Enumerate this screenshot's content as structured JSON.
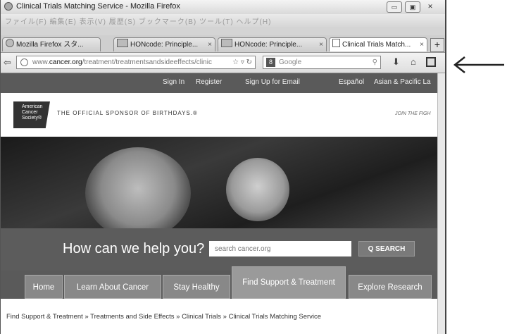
{
  "window": {
    "title": "Clinical Trials Matching Service - Mozilla Firefox",
    "menu": "ファイル(F)  編集(E)  表示(V)  履歴(S)  ブックマーク(B)  ツール(T)  ヘルプ(H)",
    "controls": {
      "minimize": "▭",
      "maximize": "▣",
      "close": "✕"
    }
  },
  "tabs": [
    {
      "label": "Mozilla Firefox スタ..."
    },
    {
      "label": "HONcode: Principle..."
    },
    {
      "label": "HONcode: Principle..."
    },
    {
      "label": "Clinical Trials Match..."
    }
  ],
  "tab_close": "×",
  "new_tab": "+",
  "address_bar": {
    "url_prefix": "www.",
    "url_domain": "cancer.org",
    "url_path": "/treatment/treatmentsandsideeffects/clinic",
    "search_engine": "Google"
  },
  "site": {
    "utility_links": [
      "Sign In",
      "Register",
      "Sign Up for Email",
      "Español",
      "Asian & Pacific La"
    ],
    "logo_text": "American Cancer Society®",
    "sponsor_text": "THE OFFICIAL SPONSOR OF BIRTHDAYS.®",
    "join_text": "JOIN THE FIGH",
    "help_heading": "How can we help you?",
    "search_placeholder": "search cancer.org",
    "search_button": "Q  SEARCH",
    "nav": [
      "Home",
      "Learn About Cancer",
      "Stay Healthy",
      "Find Support & Treatment",
      "Explore Research"
    ],
    "breadcrumb": "Find Support & Treatment » Treatments and Side Effects » Clinical Trials » Clinical Trials Matching Service"
  }
}
